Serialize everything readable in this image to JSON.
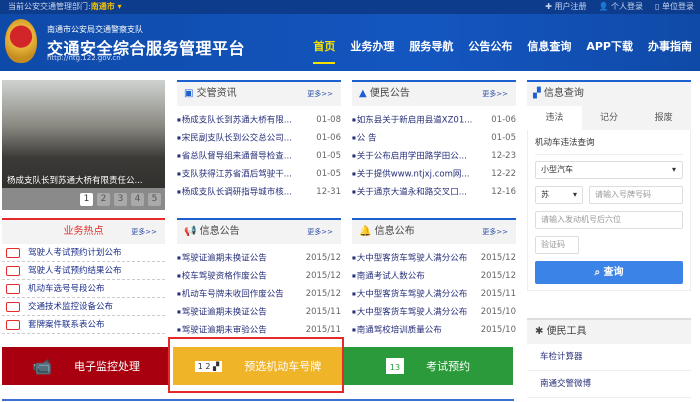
{
  "topbar": {
    "dept_label": "当前公安交通管理部门:",
    "city": "南通市 ▾",
    "register": "✚ 用户注册",
    "personal_login": "👤 个人登录",
    "unit_login": "▯ 单位登录"
  },
  "header": {
    "org": "南通市公安局交通警察支队",
    "title": "交通安全综合服务管理平台",
    "url": "http://ntg.122.gov.cn",
    "nav": [
      "首页",
      "业务办理",
      "服务导航",
      "公告公布",
      "信息查询",
      "APP下载",
      "办事指南"
    ]
  },
  "slideshow": {
    "caption": "杨成支队长到苏通大桥有限责任公...",
    "pages": [
      "1",
      "2",
      "3",
      "4",
      "5"
    ]
  },
  "hot": {
    "title": "业务热点",
    "more": "更多>>",
    "items": [
      "驾驶人考试预约计划公布",
      "驾驶人考试预约结果公布",
      "机动车选号号段公布",
      "交通技术监控设备公布",
      "套牌案件联系表公布"
    ]
  },
  "news": {
    "title": "交管资讯",
    "more": "更多>>",
    "items": [
      {
        "t": "杨成支队长到苏通大桥有限...",
        "d": "01-08"
      },
      {
        "t": "宋民副支队长到公交总公司...",
        "d": "01-06"
      },
      {
        "t": "省总队督导组来通督导检查...",
        "d": "01-05"
      },
      {
        "t": "支队获得江苏省酒后驾驶干...",
        "d": "01-05"
      },
      {
        "t": "杨成支队长调研指导城市核...",
        "d": "12-31"
      }
    ]
  },
  "notices": {
    "title": "便民公告",
    "more": "更多>>",
    "items": [
      {
        "t": "如东县关于新启用县道XZ01...",
        "d": "01-06"
      },
      {
        "t": "公 告",
        "d": "01-05"
      },
      {
        "t": "关于公布启用学田路学田公...",
        "d": "12-23"
      },
      {
        "t": "关于提供www.ntjxj.com网...",
        "d": "12-22"
      },
      {
        "t": "关于通京大道永和路交叉口...",
        "d": "12-16"
      }
    ]
  },
  "info_notice": {
    "title": "信息公告",
    "more": "更多>>",
    "items": [
      {
        "t": "驾驶证逾期未换证公告",
        "d": "2015/12"
      },
      {
        "t": "校车驾驶资格作废公告",
        "d": "2015/12"
      },
      {
        "t": "机动车号牌未收回作废公告",
        "d": "2015/12"
      },
      {
        "t": "驾驶证逾期未换证公告",
        "d": "2015/11"
      },
      {
        "t": "驾驶证逾期未审验公告",
        "d": "2015/11"
      }
    ]
  },
  "info_publish": {
    "title": "信息公布",
    "more": "更多>>",
    "items": [
      {
        "t": "大中型客货车驾驶人满分公布",
        "d": "2015/12"
      },
      {
        "t": "南通考试人数公布",
        "d": "2015/12"
      },
      {
        "t": "大中型客货车驾驶人满分公布",
        "d": "2015/11"
      },
      {
        "t": "大中型客货车驾驶人满分公布",
        "d": "2015/10"
      },
      {
        "t": "南通驾校培训质量公布",
        "d": "2015/10"
      }
    ]
  },
  "banners": {
    "monitor": "电子监控处理",
    "plate": "预选机动车号牌",
    "exam": "考试预约",
    "calendar_day": "13"
  },
  "query": {
    "title": "信息查询",
    "tabs": [
      "违法",
      "记分",
      "报废"
    ],
    "form_title": "机动车违法查询",
    "vehicle_type": "小型汽车",
    "province": "苏",
    "plate_placeholder": "请输入号牌号码",
    "engine_placeholder": "请输入发动机号后六位",
    "captcha_placeholder": "验证码",
    "submit": "查询"
  },
  "tools": {
    "title": "便民工具",
    "links": [
      "车检计算器",
      "南通交警微博"
    ]
  },
  "colors": {
    "red": "#a8000f",
    "yellow": "#f0b428",
    "green": "#2a9a3a",
    "blue": "#1456c0"
  }
}
